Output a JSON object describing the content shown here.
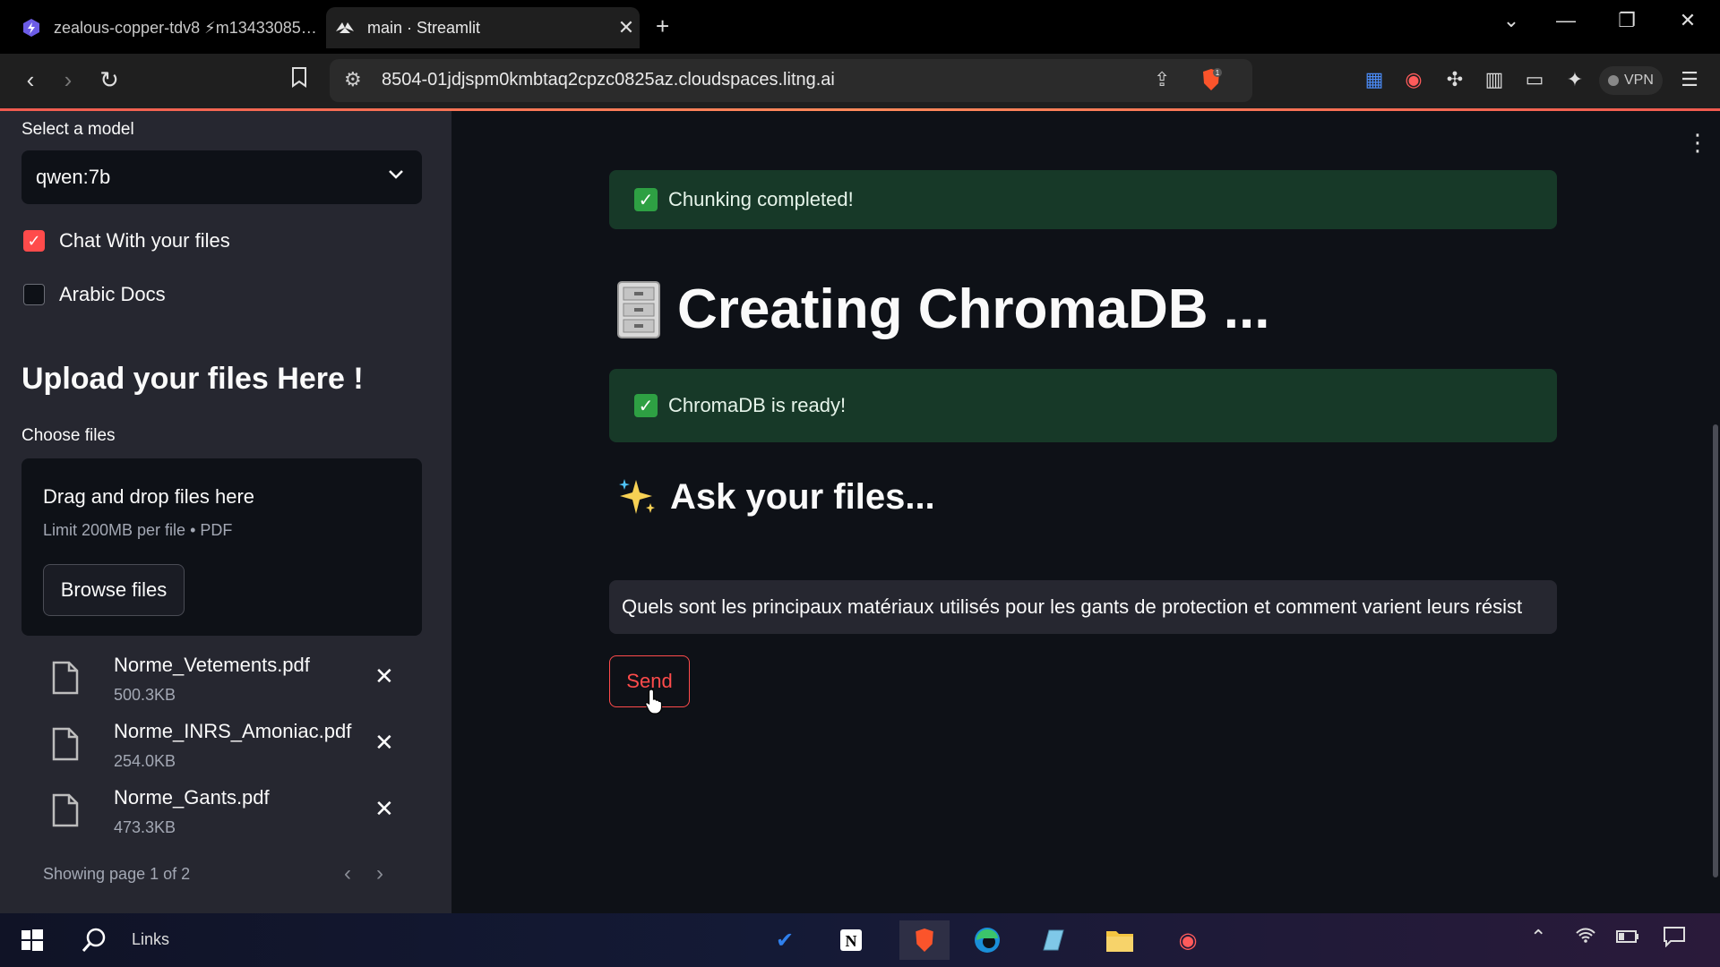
{
  "browser": {
    "tabs": [
      {
        "title": "zealous-copper-tdv8 ⚡m13433085…",
        "favicon": "lightning-ai-icon"
      },
      {
        "title": "main · Streamlit",
        "favicon": "streamlit-icon"
      }
    ],
    "url": "8504-01jdjspm0kmbtaq2cpzc0825az.cloudspaces.litng.ai",
    "shields_count": "1",
    "vpn_label": "VPN"
  },
  "sidebar": {
    "model_label": "Select a model",
    "model_value": "qwen:7b",
    "checkbox_chat": "Chat With your files",
    "checkbox_arabic": "Arabic Docs",
    "upload_header": "Upload your files Here !",
    "choose_label": "Choose files",
    "dropzone_text": "Drag and drop files here",
    "dropzone_limit": "Limit 200MB per file • PDF",
    "browse_label": "Browse files",
    "files": [
      {
        "name": "Norme_Vetements.pdf",
        "size": "500.3KB"
      },
      {
        "name": "Norme_INRS_Amoniac.pdf",
        "size": "254.0KB"
      },
      {
        "name": "Norme_Gants.pdf",
        "size": "473.3KB"
      }
    ],
    "pager_text": "Showing page 1 of 2"
  },
  "main": {
    "chunking_msg": "Chunking completed!",
    "title": "Creating ChromaDB ...",
    "chroma_msg": "ChromaDB is ready!",
    "ask_header": "Ask your files...",
    "question": "Quels sont les principaux matériaux utilisés pour les gants de protection et comment varient leurs résist",
    "send_label": "Send"
  },
  "taskbar": {
    "search_label": "Links"
  },
  "colors": {
    "accent": "#ff4b4b",
    "success_bg": "#173928",
    "sidebar_bg": "#262730",
    "app_bg": "#0e1117"
  }
}
